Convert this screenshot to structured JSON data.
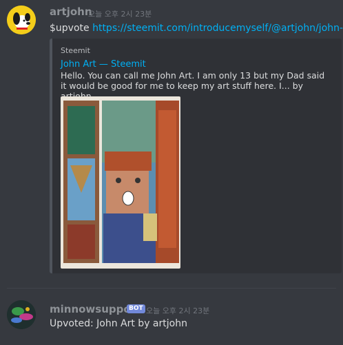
{
  "messages": [
    {
      "username": "artjohn",
      "timestamp": "오늘 오후 2시 23분",
      "text_prefix": "$upvote ",
      "link": "https://steemit.com/introducemyself/@artjohn/john-art",
      "embed": {
        "provider": "Steemit",
        "title": "John Art — Steemit",
        "description": "Hello. You can call me John Art. I am only 13 but my Dad said it would be good for me to keep my art stuff here. I... by artjohn"
      }
    },
    {
      "username": "minnowsupport",
      "badge": "BOT",
      "timestamp": "오늘 오후 2시 23분",
      "text": "Upvoted: John Art by artjohn"
    }
  ],
  "colors": {
    "background": "#36393f",
    "link": "#00b0f4",
    "bot_badge": "#7289da"
  }
}
